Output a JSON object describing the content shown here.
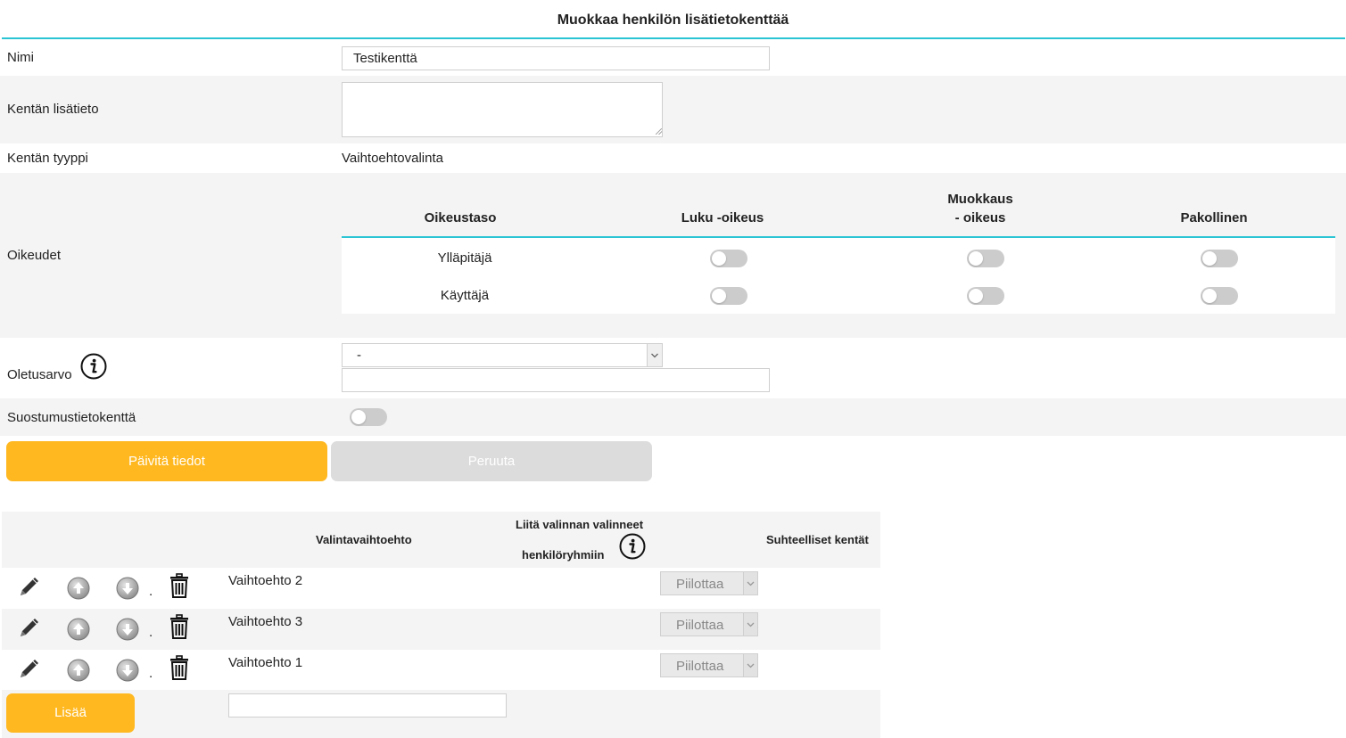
{
  "page": {
    "title": "Muokkaa henkilön lisätietokenttää"
  },
  "form": {
    "name": {
      "label": "Nimi",
      "value": "Testikenttä"
    },
    "description": {
      "label": "Kentän lisätieto",
      "value": ""
    },
    "field_type": {
      "label": "Kentän tyyppi",
      "value": "Vaihtoehtovalinta"
    },
    "permissions": {
      "label": "Oikeudet",
      "columns": {
        "level": "Oikeustaso",
        "read": "Luku -oikeus",
        "edit_line1": "Muokkaus",
        "edit_line2": "- oikeus",
        "required": "Pakollinen"
      },
      "rows": [
        {
          "role": "Ylläpitäjä",
          "read": false,
          "edit": false,
          "required": false
        },
        {
          "role": "Käyttäjä",
          "read": false,
          "edit": false,
          "required": false
        }
      ]
    },
    "default_value": {
      "label": "Oletusarvo",
      "selected": "-",
      "text": ""
    },
    "consent_field": {
      "label": "Suostumustietokenttä",
      "on": false
    }
  },
  "buttons": {
    "update": "Päivitä tiedot",
    "cancel": "Peruuta"
  },
  "options_table": {
    "headers": {
      "option": "Valintavaihtoehto",
      "groups_line1": "Liitä valinnan valinneet",
      "groups_line2": "henkilöryhmiin",
      "relative": "Suhteelliset kentät"
    },
    "rows": [
      {
        "label": "Vaihtoehto 2",
        "relative_select": "Piilottaa"
      },
      {
        "label": "Vaihtoehto 3",
        "relative_select": "Piilottaa"
      },
      {
        "label": "Vaihtoehto 1",
        "relative_select": "Piilottaa"
      }
    ],
    "row_separator": ".",
    "add_button": "Lisää",
    "new_option_value": ""
  },
  "colors": {
    "accent_rule": "#2ac4d4",
    "primary_button": "#ffb820",
    "disabled_button": "#dcdcdc",
    "row_alt": "#f4f4f4"
  },
  "icons": [
    "info-icon",
    "pencil-icon",
    "arrow-up-icon",
    "arrow-down-icon",
    "trash-icon"
  ]
}
